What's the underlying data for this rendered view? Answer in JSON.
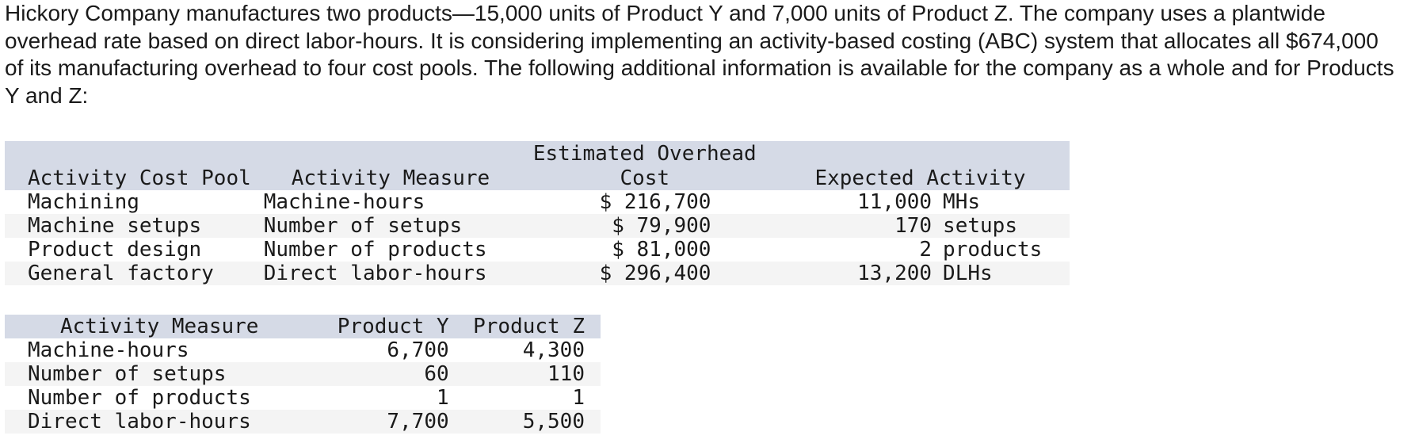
{
  "intro_text": "Hickory Company manufactures two products—15,000 units of Product Y and 7,000 units of Product Z. The company uses a plantwide overhead rate based on direct labor-hours. It is considering implementing an activity-based costing (ABC) system that allocates all $674,000 of its manufacturing overhead to four cost pools. The following additional information is available for the company as a whole and for Products Y and Z:",
  "pool_table": {
    "headers": {
      "pool": "Activity Cost Pool",
      "measure": "Activity Measure",
      "cost_line1": "Estimated Overhead",
      "cost_line2": "Cost",
      "activity": "Expected Activity"
    },
    "rows": [
      {
        "pool": "Machining",
        "measure": "Machine-hours",
        "cost": "$ 216,700",
        "activity_qty": "11,000",
        "activity_unit": "MHs"
      },
      {
        "pool": "Machine setups",
        "measure": "Number of setups",
        "cost": "$ 79,900",
        "activity_qty": "170",
        "activity_unit": "setups"
      },
      {
        "pool": "Product design",
        "measure": "Number of products",
        "cost": "$ 81,000",
        "activity_qty": "2",
        "activity_unit": "products"
      },
      {
        "pool": "General factory",
        "measure": "Direct labor-hours",
        "cost": "$ 296,400",
        "activity_qty": "13,200",
        "activity_unit": "DLHs"
      }
    ]
  },
  "product_table": {
    "headers": {
      "measure": "Activity Measure",
      "product_y": "Product Y",
      "product_z": "Product Z"
    },
    "rows": [
      {
        "measure": "Machine-hours",
        "product_y": "6,700",
        "product_z": "4,300"
      },
      {
        "measure": "Number of setups",
        "product_y": "60",
        "product_z": "110"
      },
      {
        "measure": "Number of products",
        "product_y": "1",
        "product_z": "1"
      },
      {
        "measure": "Direct labor-hours",
        "product_y": "7,700",
        "product_z": "5,500"
      }
    ]
  }
}
